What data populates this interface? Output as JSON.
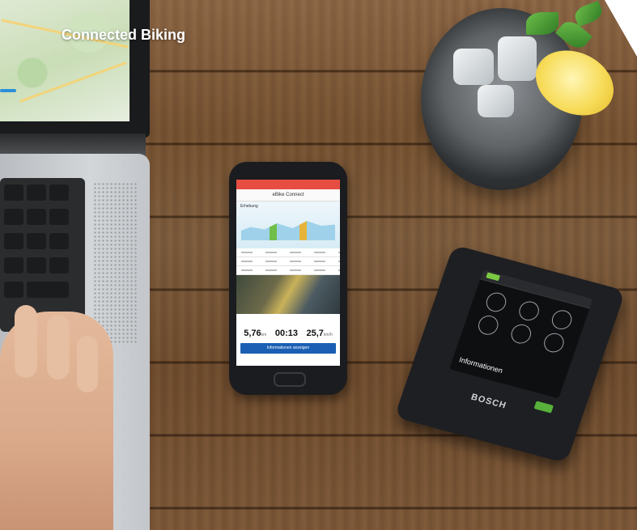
{
  "header": {
    "title": "Connected Biking"
  },
  "scene": {
    "objects": [
      "laptop-icon",
      "smartphone-icon",
      "bike-display-icon",
      "drink-glass-icon"
    ]
  },
  "phone": {
    "app_title": "eBike Connect",
    "chart_label": "Erhebung",
    "stats": [
      {
        "value": "5,76",
        "unit": "km"
      },
      {
        "value": "00:13",
        "unit": ""
      },
      {
        "value": "25,7",
        "unit": "km/h"
      }
    ],
    "button_label": "Informationen anzeigen"
  },
  "nyon": {
    "menu_label": "Informationen",
    "brand": "BOSCH"
  },
  "colors": {
    "title": "#ffffff",
    "phone_button": "#1a5fb4",
    "nyon_accent": "#57b13a"
  }
}
